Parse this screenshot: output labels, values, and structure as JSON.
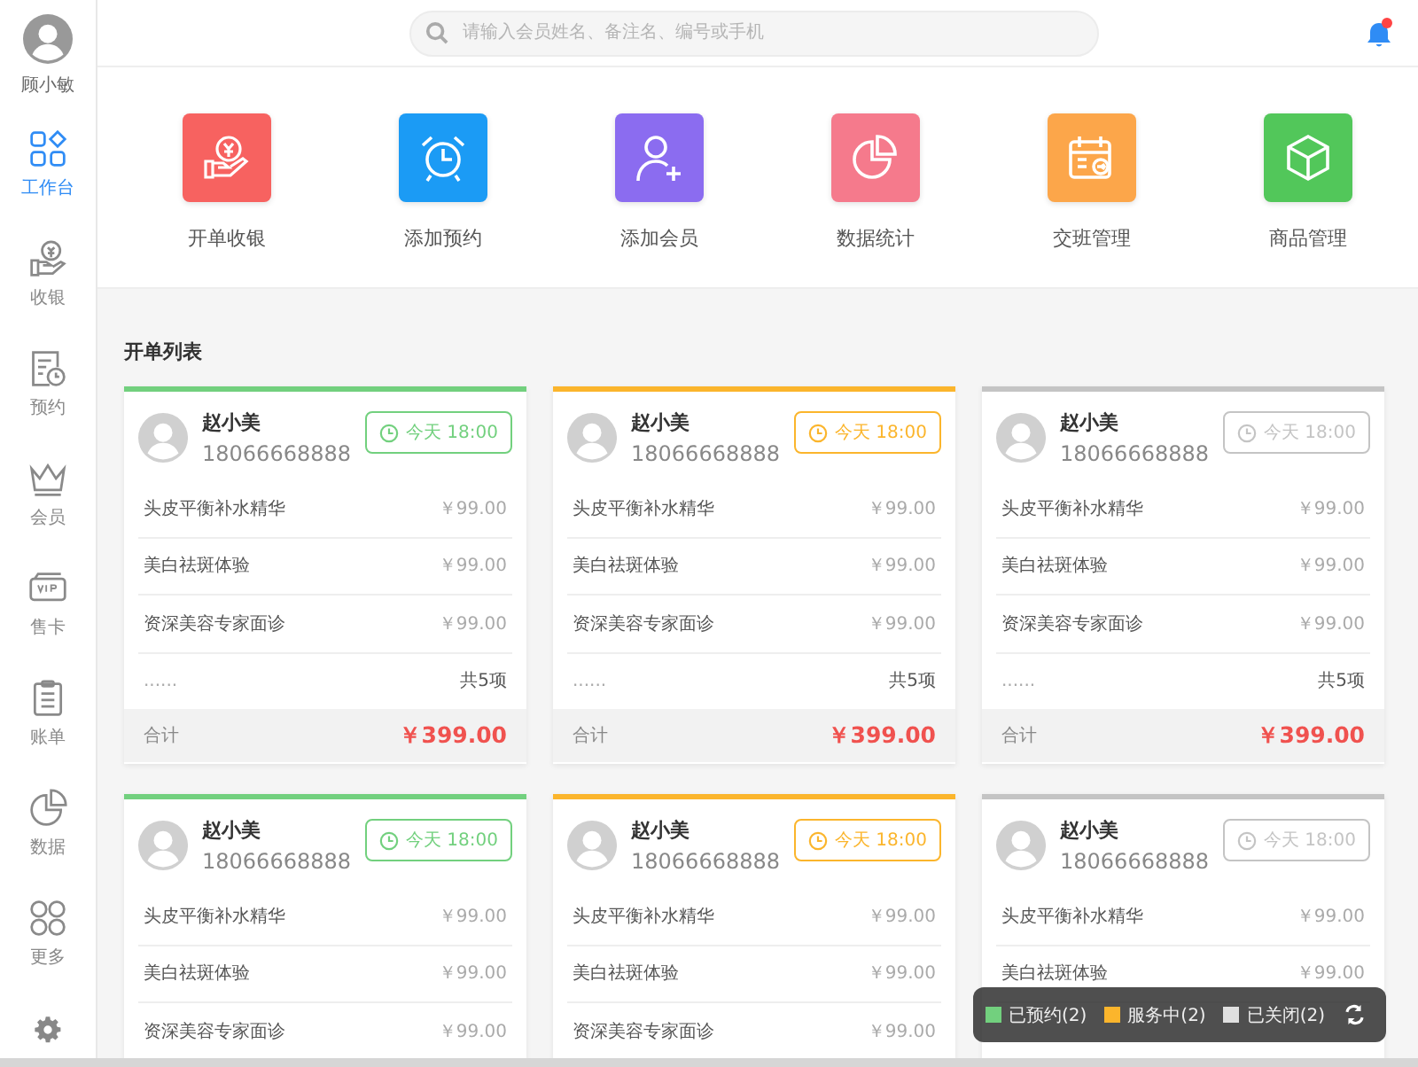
{
  "sidebar": {
    "user": {
      "name": "顾小敏"
    },
    "items": [
      {
        "label": "工作台",
        "selected": true
      },
      {
        "label": "收银",
        "selected": false
      },
      {
        "label": "预约",
        "selected": false
      },
      {
        "label": "会员",
        "selected": false
      },
      {
        "label": "售卡",
        "selected": false
      },
      {
        "label": "账单",
        "selected": false
      },
      {
        "label": "数据",
        "selected": false
      },
      {
        "label": "更多",
        "selected": false
      }
    ]
  },
  "search": {
    "placeholder": "请输入会员姓名、备注名、编号或手机"
  },
  "notifications": {
    "unread": true
  },
  "quick_actions": [
    {
      "label": "开单收银",
      "color": "#f76260"
    },
    {
      "label": "添加预约",
      "color": "#1b9bf5"
    },
    {
      "label": "添加会员",
      "color": "#8b6cf0"
    },
    {
      "label": "数据统计",
      "color": "#f57a8c"
    },
    {
      "label": "交班管理",
      "color": "#fca64a"
    },
    {
      "label": "商品管理",
      "color": "#52c75a"
    }
  ],
  "order_list": {
    "title": "开单列表",
    "cards": [
      {
        "color": "#72d07e",
        "name": "赵小美",
        "phone": "18066668888",
        "time": "今天 18:00",
        "items": [
          {
            "name": "头皮平衡补水精华",
            "price": "￥99.00"
          },
          {
            "name": "美白祛斑体验",
            "price": "￥99.00"
          },
          {
            "name": "资深美容专家面诊",
            "price": "￥99.00"
          }
        ],
        "more": "......",
        "count": "共5项",
        "total_label": "合计",
        "total": "￥399.00"
      },
      {
        "color": "#fbb52c",
        "name": "赵小美",
        "phone": "18066668888",
        "time": "今天 18:00",
        "items": [
          {
            "name": "头皮平衡补水精华",
            "price": "￥99.00"
          },
          {
            "name": "美白祛斑体验",
            "price": "￥99.00"
          },
          {
            "name": "资深美容专家面诊",
            "price": "￥99.00"
          }
        ],
        "more": "......",
        "count": "共5项",
        "total_label": "合计",
        "total": "￥399.00"
      },
      {
        "color": "#c4c4c4",
        "name": "赵小美",
        "phone": "18066668888",
        "time": "今天 18:00",
        "items": [
          {
            "name": "头皮平衡补水精华",
            "price": "￥99.00"
          },
          {
            "name": "美白祛斑体验",
            "price": "￥99.00"
          },
          {
            "name": "资深美容专家面诊",
            "price": "￥99.00"
          }
        ],
        "more": "......",
        "count": "共5项",
        "total_label": "合计",
        "total": "￥399.00"
      },
      {
        "color": "#72d07e",
        "name": "赵小美",
        "phone": "18066668888",
        "time": "今天 18:00",
        "items": [
          {
            "name": "头皮平衡补水精华",
            "price": "￥99.00"
          },
          {
            "name": "美白祛斑体验",
            "price": "￥99.00"
          },
          {
            "name": "资深美容专家面诊",
            "price": "￥99.00"
          }
        ]
      },
      {
        "color": "#fbb52c",
        "name": "赵小美",
        "phone": "18066668888",
        "time": "今天 18:00",
        "items": [
          {
            "name": "头皮平衡补水精华",
            "price": "￥99.00"
          },
          {
            "name": "美白祛斑体验",
            "price": "￥99.00"
          },
          {
            "name": "资深美容专家面诊",
            "price": "￥99.00"
          }
        ]
      },
      {
        "color": "#c4c4c4",
        "name": "赵小美",
        "phone": "18066668888",
        "time": "今天 18:00",
        "items": [
          {
            "name": "头皮平衡补水精华",
            "price": "￥99.00"
          },
          {
            "name": "美白祛斑体验",
            "price": "￥99.00"
          }
        ]
      }
    ]
  },
  "legend": [
    {
      "label": "已预约(2)",
      "color": "#72d07e"
    },
    {
      "label": "服务中(2)",
      "color": "#fbb52c"
    },
    {
      "label": "已关闭(2)",
      "color": "#e0e0e0"
    }
  ]
}
